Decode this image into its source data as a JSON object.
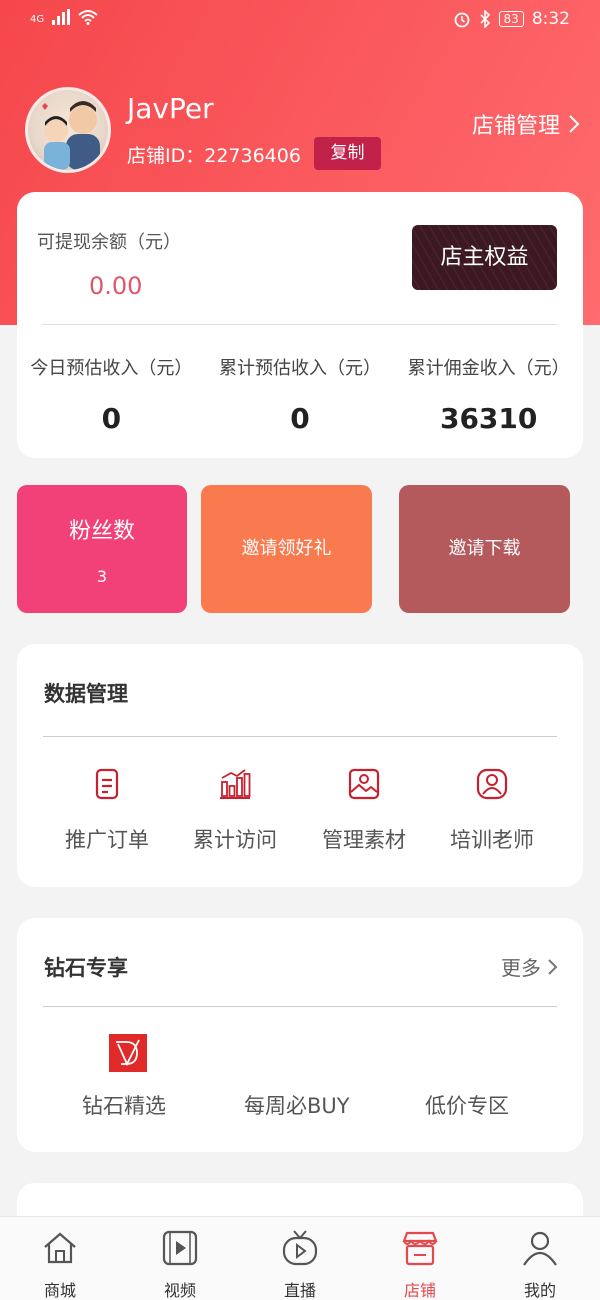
{
  "status_bar": {
    "network": "4G",
    "battery": "83",
    "time": "8:32"
  },
  "profile": {
    "name": "JavPer",
    "shop_id": "店铺ID：22736406",
    "copy_label": "复制",
    "manage_label": "店铺管理"
  },
  "balance": {
    "label": "可提现余额（元）",
    "value": "0.00",
    "rights_label": "店主权益",
    "stats": [
      {
        "label": "今日预估收入（元）",
        "value": "0"
      },
      {
        "label": "累计预估收入（元）",
        "value": "0"
      },
      {
        "label": "累计佣金收入（元）",
        "value": "36310"
      }
    ]
  },
  "tiles": {
    "fans_label": "粉丝数",
    "fans_count": "3",
    "invite_label": "邀请领好礼",
    "download_label": "邀请下载"
  },
  "data_management": {
    "title": "数据管理",
    "items": [
      {
        "label": "推广订单",
        "icon": "order-icon"
      },
      {
        "label": "累计访问",
        "icon": "bar-chart-icon"
      },
      {
        "label": "管理素材",
        "icon": "image-icon"
      },
      {
        "label": "培训老师",
        "icon": "teacher-icon"
      }
    ]
  },
  "diamond": {
    "title": "钻石专享",
    "more_label": "更多",
    "items": [
      {
        "label": "钻石精选"
      },
      {
        "label": "每周必BUY"
      },
      {
        "label": "低价专区"
      }
    ]
  },
  "tabbar": {
    "items": [
      {
        "label": "商城",
        "icon": "home-icon"
      },
      {
        "label": "视频",
        "icon": "video-icon"
      },
      {
        "label": "直播",
        "icon": "tv-icon"
      },
      {
        "label": "店铺",
        "icon": "store-icon"
      },
      {
        "label": "我的",
        "icon": "user-icon"
      }
    ],
    "active": "店铺"
  },
  "colors": {
    "brand": "#f5474c",
    "copy_button": "#c2214a",
    "fans_tile": "#f24179",
    "invite_tile": "#fa7a4f",
    "download_tile": "#b55a5c",
    "icon_red": "#c8202e"
  }
}
